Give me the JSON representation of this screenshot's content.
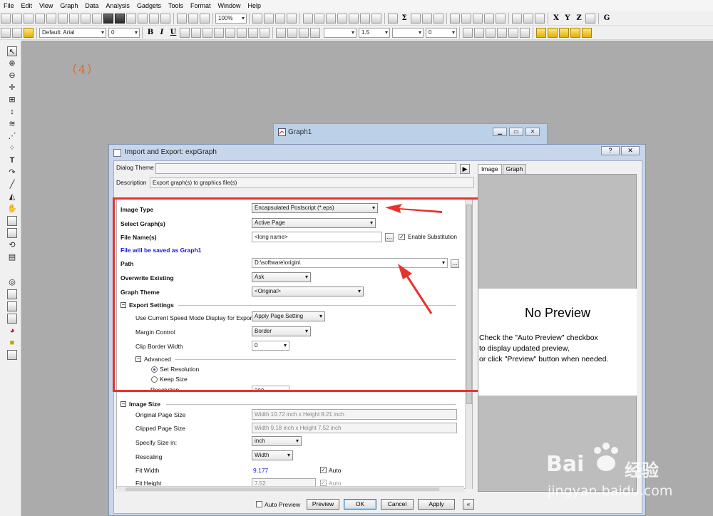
{
  "menu": [
    "File",
    "Edit",
    "View",
    "Graph",
    "Data",
    "Analysis",
    "Gadgets",
    "Tools",
    "Format",
    "Window",
    "Help"
  ],
  "toolbar": {
    "zoom": "100%",
    "font_name": "Default: Arial",
    "font_size": "0",
    "line_width": "1.5",
    "border_width": "0",
    "bold": "B",
    "italic": "I",
    "underline": "U"
  },
  "step_label": "（4）",
  "graph_window": {
    "title": "Graph1"
  },
  "dialog": {
    "title": "Import and Export: expGraph",
    "help": "?",
    "close": "✕",
    "dialog_theme_label": "Dialog Theme",
    "dialog_theme_value": "",
    "description_label": "Description",
    "description_value": "Export graph(s) to graphics file(s)",
    "image_type_label": "Image Type",
    "image_type_value": "Encapsulated Postscript (*.eps)",
    "select_graphs_label": "Select Graph(s)",
    "select_graphs_value": "Active Page",
    "file_name_label": "File Name(s)",
    "file_name_value": "<long name>",
    "enable_substitution_label": "Enable Substitution",
    "saved_as_note": "File will be saved as Graph1",
    "path_label": "Path",
    "path_value": "D:\\software\\origin\\",
    "overwrite_label": "Overwrite Existing",
    "overwrite_value": "Ask",
    "graph_theme_label": "Graph Theme",
    "graph_theme_value": "<Original>",
    "export_settings_label": "Export Settings",
    "speed_mode_label": "Use Current Speed Mode Display for Export",
    "speed_mode_value": "Apply Page Setting",
    "margin_control_label": "Margin Control",
    "margin_control_value": "Border",
    "clip_border_label": "Clip Border Width",
    "clip_border_value": "0",
    "advanced_label": "Advanced",
    "set_resolution_label": "Set Resolution",
    "keep_size_label": "Keep Size",
    "resolution_label": "Resolution",
    "resolution_value": "300",
    "image_size_label": "Image Size",
    "original_page_size_label": "Original Page Size",
    "original_page_size_value": "Width 10.72 inch x Height 8.21 inch",
    "clipped_page_size_label": "Clipped Page Size",
    "clipped_page_size_value": "Width 9.18 inch x Height 7.52 inch",
    "specify_size_label": "Specify Size in:",
    "specify_size_value": "inch",
    "rescaling_label": "Rescaling",
    "rescaling_value": "Width",
    "fit_width_label": "Fit Width",
    "fit_width_value": "9.177",
    "fit_width_auto_label": "Auto",
    "fit_height_label": "Fit Height",
    "fit_height_value": "7.52",
    "fit_height_auto_label": "Auto",
    "preview_tabs": [
      "Image",
      "Graph"
    ],
    "no_preview_title": "No Preview",
    "no_preview_line1": "Check the \"Auto Preview\" checkbox",
    "no_preview_line2": "to display updated preview,",
    "no_preview_line3": "or click \"Preview\" button when needed.",
    "auto_preview_label": "Auto Preview",
    "preview_button": "Preview",
    "ok_button": "OK",
    "cancel_button": "Cancel",
    "apply_button": "Apply",
    "collapse_button": "«"
  },
  "watermark": {
    "brand": "Bai",
    "brand_cn": "经验",
    "url": "jingyan.baidu.com"
  },
  "colors": {
    "annotation_red": "#e8332c",
    "note_blue": "#1a1adb",
    "workspace_gray": "#ababab"
  }
}
